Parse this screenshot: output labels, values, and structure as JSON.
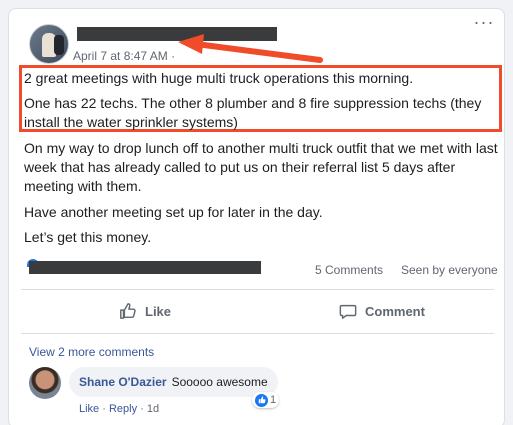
{
  "post": {
    "timestamp": "April 7 at 8:47 AM",
    "paragraphs": [
      "2 great meetings with huge multi truck operations this morning.",
      "One has 22 techs. The other 8 plumber and 8 fire suppression techs (they install the water sprinkler systems)",
      "On my way to drop lunch off to another multi truck outfit that we met with last week that has already called to put us on their referral list 5 days after meeting with them.",
      "Have another meeting set up for later in the day.",
      "Let’s get this money."
    ]
  },
  "stats": {
    "comments": "5 Comments",
    "seen": "Seen by everyone"
  },
  "actions": {
    "like": "Like",
    "comment": "Comment"
  },
  "comments": {
    "view_more": "View 2 more comments",
    "items": [
      {
        "author": "Shane O'Dazier",
        "text": "Sooooo awesome",
        "like": "Like",
        "reply": "Reply",
        "time": "1d",
        "reaction_count": "1"
      }
    ]
  },
  "colors": {
    "highlight": "#f14c2a",
    "link": "#385898",
    "facebook_blue": "#1877f2"
  }
}
